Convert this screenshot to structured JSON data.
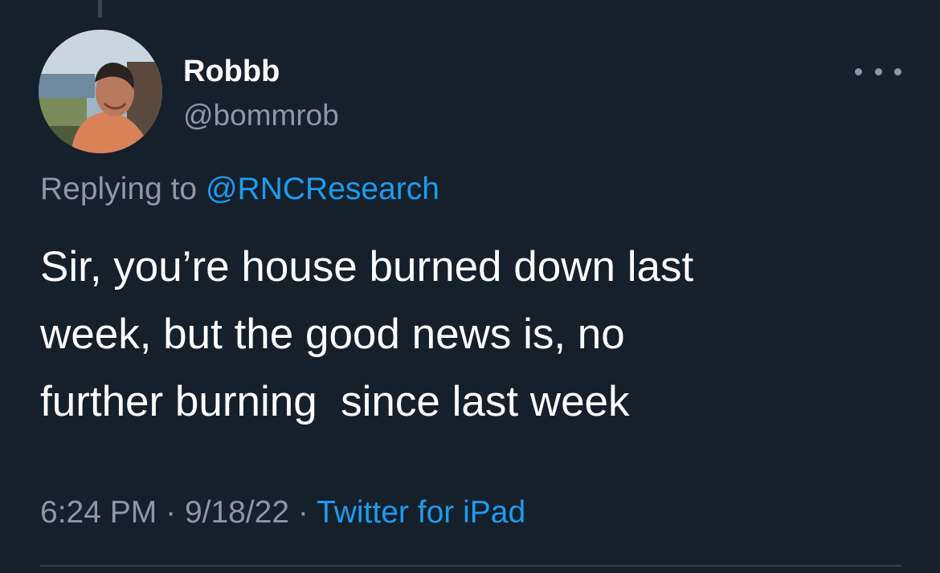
{
  "author": {
    "display_name": "Robbb",
    "handle": "@bommrob"
  },
  "reply_context": {
    "prefix": "Replying to",
    "mention": "@RNCResearch"
  },
  "tweet": {
    "text_lines": [
      "Sir, you’re house burned down last",
      "week, but the good news is, no",
      "further burning  since last week"
    ]
  },
  "meta": {
    "time": "6:24 PM",
    "date": "9/18/22",
    "separator": "·",
    "source": "Twitter for iPad"
  },
  "icons": {
    "more": "more-horizontal-icon",
    "avatar": "profile-photo"
  },
  "colors": {
    "background": "#15202b",
    "primary_text": "#ffffff",
    "secondary_text": "#8b98a5",
    "link": "#1d9bf0",
    "divider": "#38444d"
  }
}
